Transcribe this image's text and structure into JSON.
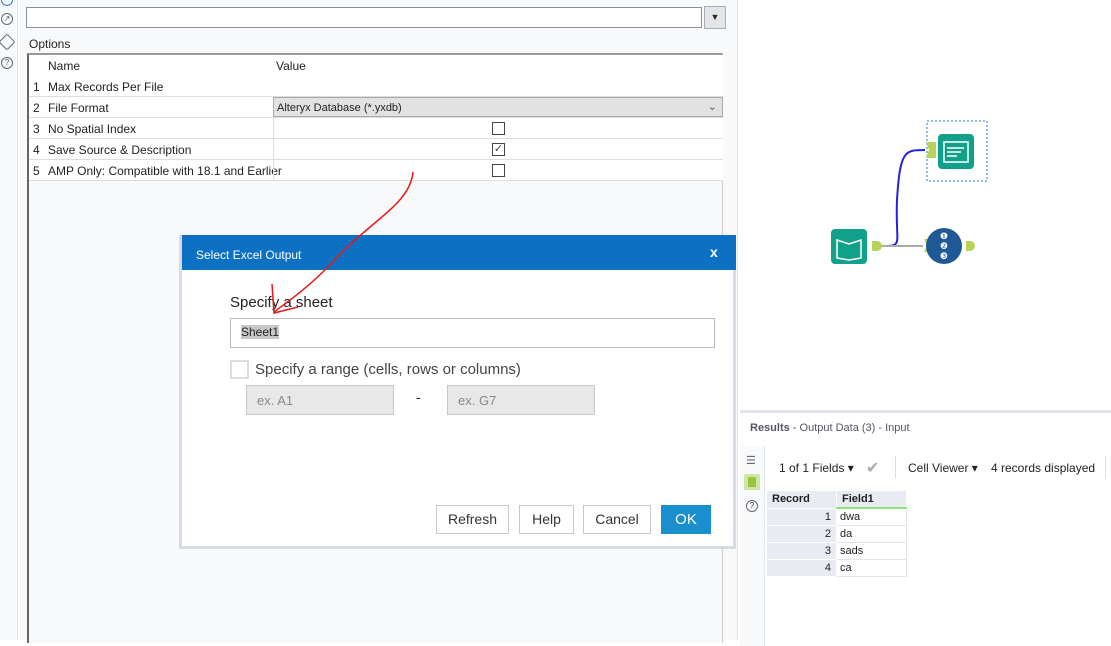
{
  "config": {
    "options_label": "Options",
    "grid": {
      "headers": {
        "name": "Name",
        "value": "Value"
      },
      "rows": [
        {
          "num": "1",
          "name": "Max Records Per File",
          "value": ""
        },
        {
          "num": "2",
          "name": "File Format",
          "value": "Alteryx Database (*.yxdb)"
        },
        {
          "num": "3",
          "name": "No Spatial Index",
          "checked": false
        },
        {
          "num": "4",
          "name": "Save Source & Description",
          "checked": true
        },
        {
          "num": "5",
          "name": "AMP Only: Compatible with 18.1 and Earlier",
          "checked": false
        }
      ]
    }
  },
  "dialog": {
    "title": "Select Excel Output",
    "close": "x",
    "sheet_label": "Specify a sheet",
    "sheet_value": "Sheet1",
    "range_label": "Specify a range (cells, rows or columns)",
    "range_from_placeholder": "ex. A1",
    "range_sep": "-",
    "range_to_placeholder": "ex. G7",
    "buttons": {
      "refresh": "Refresh",
      "help": "Help",
      "cancel": "Cancel",
      "ok": "OK"
    }
  },
  "results": {
    "title": "Results",
    "subtitle": " - Output Data (3) - Input",
    "fields_select": "1 of 1 Fields",
    "cell_viewer": "Cell Viewer",
    "records_displayed": "4 records displayed",
    "columns": [
      "Record",
      "Field1"
    ],
    "rows": [
      [
        "1",
        "dwa"
      ],
      [
        "2",
        "da"
      ],
      [
        "3",
        "sads"
      ],
      [
        "4",
        "ca"
      ]
    ]
  },
  "colors": {
    "accent": "#0c71c3",
    "ok": "#1a8fce",
    "tool_teal": "#11a08a",
    "connector": "#b8d35a",
    "tool_navy": "#1f5a96"
  }
}
